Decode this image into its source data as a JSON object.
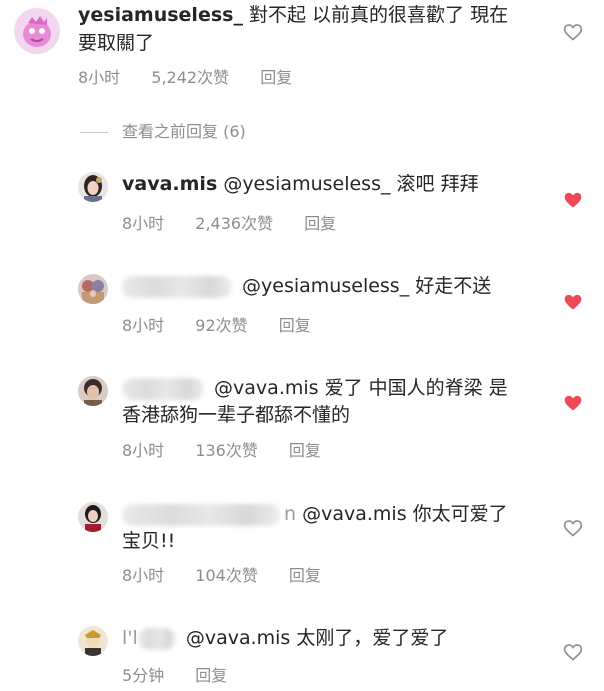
{
  "comments": [
    {
      "username": "yesiamuseless_",
      "text_line1": "對不起 以前真的很喜歡了 現在",
      "text_line2": "要取關了",
      "time": "8小时",
      "likes": "5,242次赞",
      "reply": "回复",
      "liked": false
    },
    {
      "username": "vava.mis",
      "mention": "@yesiamuseless_",
      "text_line1": "滚吧 拜拜",
      "time": "8小时",
      "likes": "2,436次赞",
      "reply": "回复",
      "liked": true
    },
    {
      "mention": "@yesiamuseless_",
      "text_line1": "好走不送",
      "time": "8小时",
      "likes": "92次赞",
      "reply": "回复",
      "liked": true
    },
    {
      "mention": "@vava.mis",
      "text_line1": "爱了 中国人的脊梁 是",
      "text_line2": "香港舔狗一辈子都舔不懂的",
      "time": "8小时",
      "likes": "136次赞",
      "reply": "回复",
      "liked": true
    },
    {
      "partial_username_char": "n",
      "mention": "@vava.mis",
      "text_line1": "你太可爱了",
      "text_line2": "宝贝!!",
      "time": "8小时",
      "likes": "104次赞",
      "reply": "回复",
      "liked": false
    },
    {
      "partial_username_chars": "l'l",
      "mention": "@vava.mis",
      "text_line1": "太刚了，爱了爱了",
      "time": "5分钟",
      "reply": "回复",
      "liked": false
    }
  ],
  "view_previous_replies": "查看之前回复 (6)",
  "colors": {
    "text": "#262626",
    "meta": "#8e8e8e",
    "heart_liked": "#ed4956",
    "heart_outline": "#8e8e8e"
  }
}
